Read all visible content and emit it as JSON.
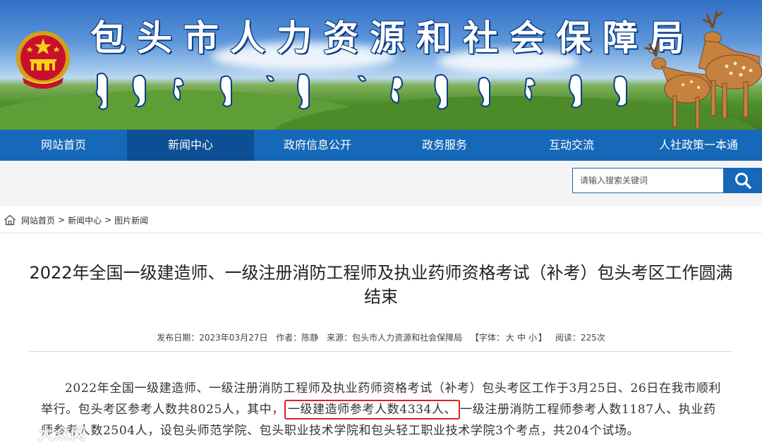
{
  "header": {
    "site_title": "包头市人力资源和社会保障局",
    "colors": {
      "nav": "#1668b8",
      "nav_active": "#0d4f94",
      "title_outline": "#0b3d8a",
      "highlight_border": "#e02020"
    }
  },
  "nav": {
    "items": [
      {
        "label": "网站首页"
      },
      {
        "label": "新闻中心"
      },
      {
        "label": "政府信息公开"
      },
      {
        "label": "政务服务"
      },
      {
        "label": "互动交流"
      },
      {
        "label": "人社政策一本通"
      }
    ],
    "active_index": 1
  },
  "search": {
    "placeholder": "请输入搜索关键词",
    "icon": "search-icon"
  },
  "breadcrumb": {
    "icon": "home-icon",
    "items": [
      "网站首页",
      "新闻中心",
      "图片新闻"
    ],
    "separator": ">"
  },
  "article": {
    "title": "2022年全国一级建造师、一级注册消防工程师及执业药师资格考试（补考）包头考区工作圆满结束",
    "meta": {
      "date_label": "发布日期：",
      "date": "2023年03月27日",
      "author_label": "作者：",
      "author": "陈静",
      "source_label": "来源：",
      "source": "包头市人力资源和社会保障局",
      "font_label": "【字体：",
      "font_large": "大",
      "font_medium": "中",
      "font_small": "小",
      "font_close": "】",
      "views_label": "阅读：",
      "views": "225次"
    },
    "body": {
      "part1": "2022年全国一级建造师、一级注册消防工程师及执业药师资格考试（补考）包头考区工作于3月25日、26日在我市顺利举行。包头考区参考人数共8025人，其中，",
      "highlight": "一级建造师参考人数4334人、",
      "part2": "一级注册消防工程师参考人数1187人、执业药师参考人数2504人，设包头师范学院、包头职业技术学院和包头轻工职业技术学院3个考点，共204个试场。"
    }
  },
  "watermark": {
    "text": "大众网"
  }
}
